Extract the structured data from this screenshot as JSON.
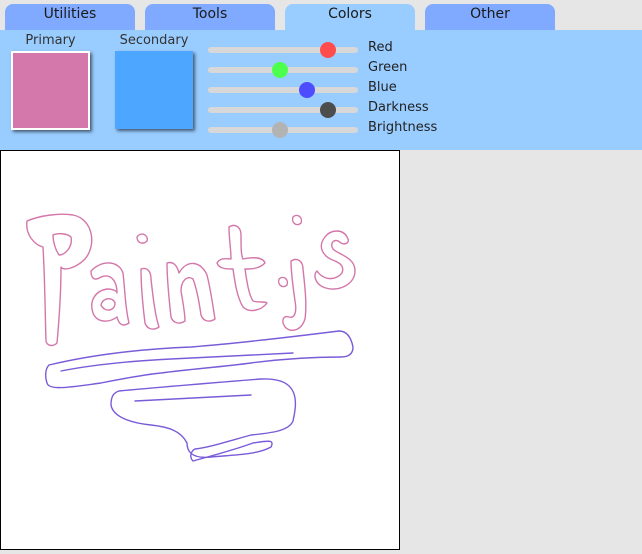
{
  "tabs": [
    {
      "label": "Utilities",
      "active": false
    },
    {
      "label": "Tools",
      "active": false
    },
    {
      "label": "Colors",
      "active": true
    },
    {
      "label": "Other",
      "active": false
    }
  ],
  "colors": {
    "primary_label": "Primary",
    "secondary_label": "Secondary",
    "primary_color": "#d477aa",
    "secondary_color": "#4da6ff"
  },
  "sliders": [
    {
      "label": "Red",
      "value": 0.8,
      "thumb_color": "#ff4d4d"
    },
    {
      "label": "Green",
      "value": 0.48,
      "thumb_color": "#4dff4d"
    },
    {
      "label": "Blue",
      "value": 0.66,
      "thumb_color": "#4d4dff"
    },
    {
      "label": "Darkness",
      "value": 0.8,
      "thumb_color": "#4d4d4d"
    },
    {
      "label": "Brightness",
      "value": 0.48,
      "thumb_color": "#b3b3b3"
    }
  ],
  "drawing": {
    "stroke_text_color": "#d477aa",
    "stroke_swirl_color": "#7a5cd9"
  }
}
